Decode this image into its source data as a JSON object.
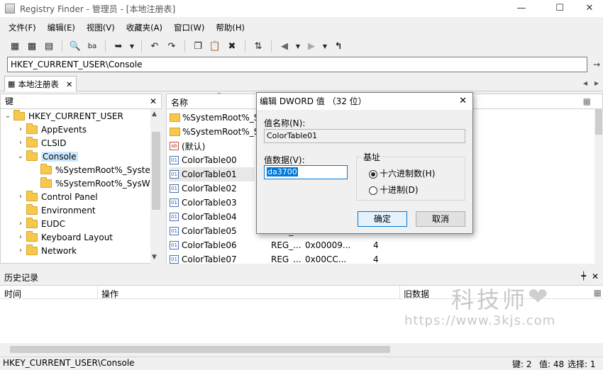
{
  "window": {
    "title": "Registry Finder - 管理员 - [本地注册表]",
    "minimize": "—",
    "maximize": "☐",
    "close": "✕"
  },
  "menu": [
    "文件(F)",
    "编辑(E)",
    "视图(V)",
    "收藏夹(A)",
    "窗口(W)",
    "帮助(H)"
  ],
  "address": {
    "value": "HKEY_CURRENT_USER\\Console",
    "go": "→"
  },
  "tab": {
    "label": "本地注册表",
    "close": "✕"
  },
  "tab_scroll": {
    "left": "◂",
    "right": "▸"
  },
  "left_pane": {
    "header": "键",
    "close": "✕",
    "tree": [
      {
        "label": "HKEY_CURRENT_USER",
        "arrow": "⌄"
      },
      {
        "label": "AppEvents",
        "arrow": "›"
      },
      {
        "label": "CLSID",
        "arrow": "›"
      },
      {
        "label": "Console",
        "arrow": "⌄"
      },
      {
        "label": "%SystemRoot%_System",
        "arrow": ""
      },
      {
        "label": "%SystemRoot%_SysWO",
        "arrow": ""
      },
      {
        "label": "Control Panel",
        "arrow": "›"
      },
      {
        "label": "Environment",
        "arrow": ""
      },
      {
        "label": "EUDC",
        "arrow": "›"
      },
      {
        "label": "Keyboard Layout",
        "arrow": "›"
      },
      {
        "label": "Network",
        "arrow": "›"
      }
    ]
  },
  "right_pane": {
    "col_name": "名称",
    "rows": [
      {
        "name": "%SystemRoot%_Sys",
        "type": "",
        "data": "",
        "size": ""
      },
      {
        "name": "%SystemRoot%_Sys",
        "type": "",
        "data": "",
        "size": ""
      },
      {
        "name": "(默认)",
        "type": "",
        "data": "",
        "size": ""
      },
      {
        "name": "ColorTable00",
        "type": "",
        "data": "",
        "size": ""
      },
      {
        "name": "ColorTable01",
        "type": "",
        "data": "",
        "size": ""
      },
      {
        "name": "ColorTable02",
        "type": "",
        "data": "",
        "size": ""
      },
      {
        "name": "ColorTable03",
        "type": "",
        "data": "",
        "size": ""
      },
      {
        "name": "ColorTable04",
        "type": "",
        "data": "",
        "size": ""
      },
      {
        "name": "ColorTable05",
        "type": "REG_",
        "data": "",
        "size": ""
      },
      {
        "name": "ColorTable06",
        "type": "REG_...",
        "data": "0x00009...",
        "size": "4"
      },
      {
        "name": "ColorTable07",
        "type": "REG_...",
        "data": "0x00CC...",
        "size": "4"
      }
    ]
  },
  "history": {
    "title": "历史记录",
    "pin": "📌",
    "close": "✕",
    "cols": {
      "time": "时间",
      "action": "操作",
      "old": "旧数据"
    }
  },
  "status": {
    "path": "HKEY_CURRENT_USER\\Console",
    "keys": "键: 2",
    "values": "值: 48",
    "selected": "选择: 1"
  },
  "dialog": {
    "title": "编辑 DWORD 值 （32 位）",
    "close": "✕",
    "name_label": "值名称(N):",
    "name_value": "ColorTable01",
    "data_label": "值数据(V):",
    "data_value": "da3700",
    "base_label": "基址",
    "hex_label": "十六进制数(H)",
    "dec_label": "十进制(D)",
    "ok": "确定",
    "cancel": "取消"
  },
  "watermark": {
    "line1": "科技师",
    "line2": "https://www.3kjs.com"
  }
}
